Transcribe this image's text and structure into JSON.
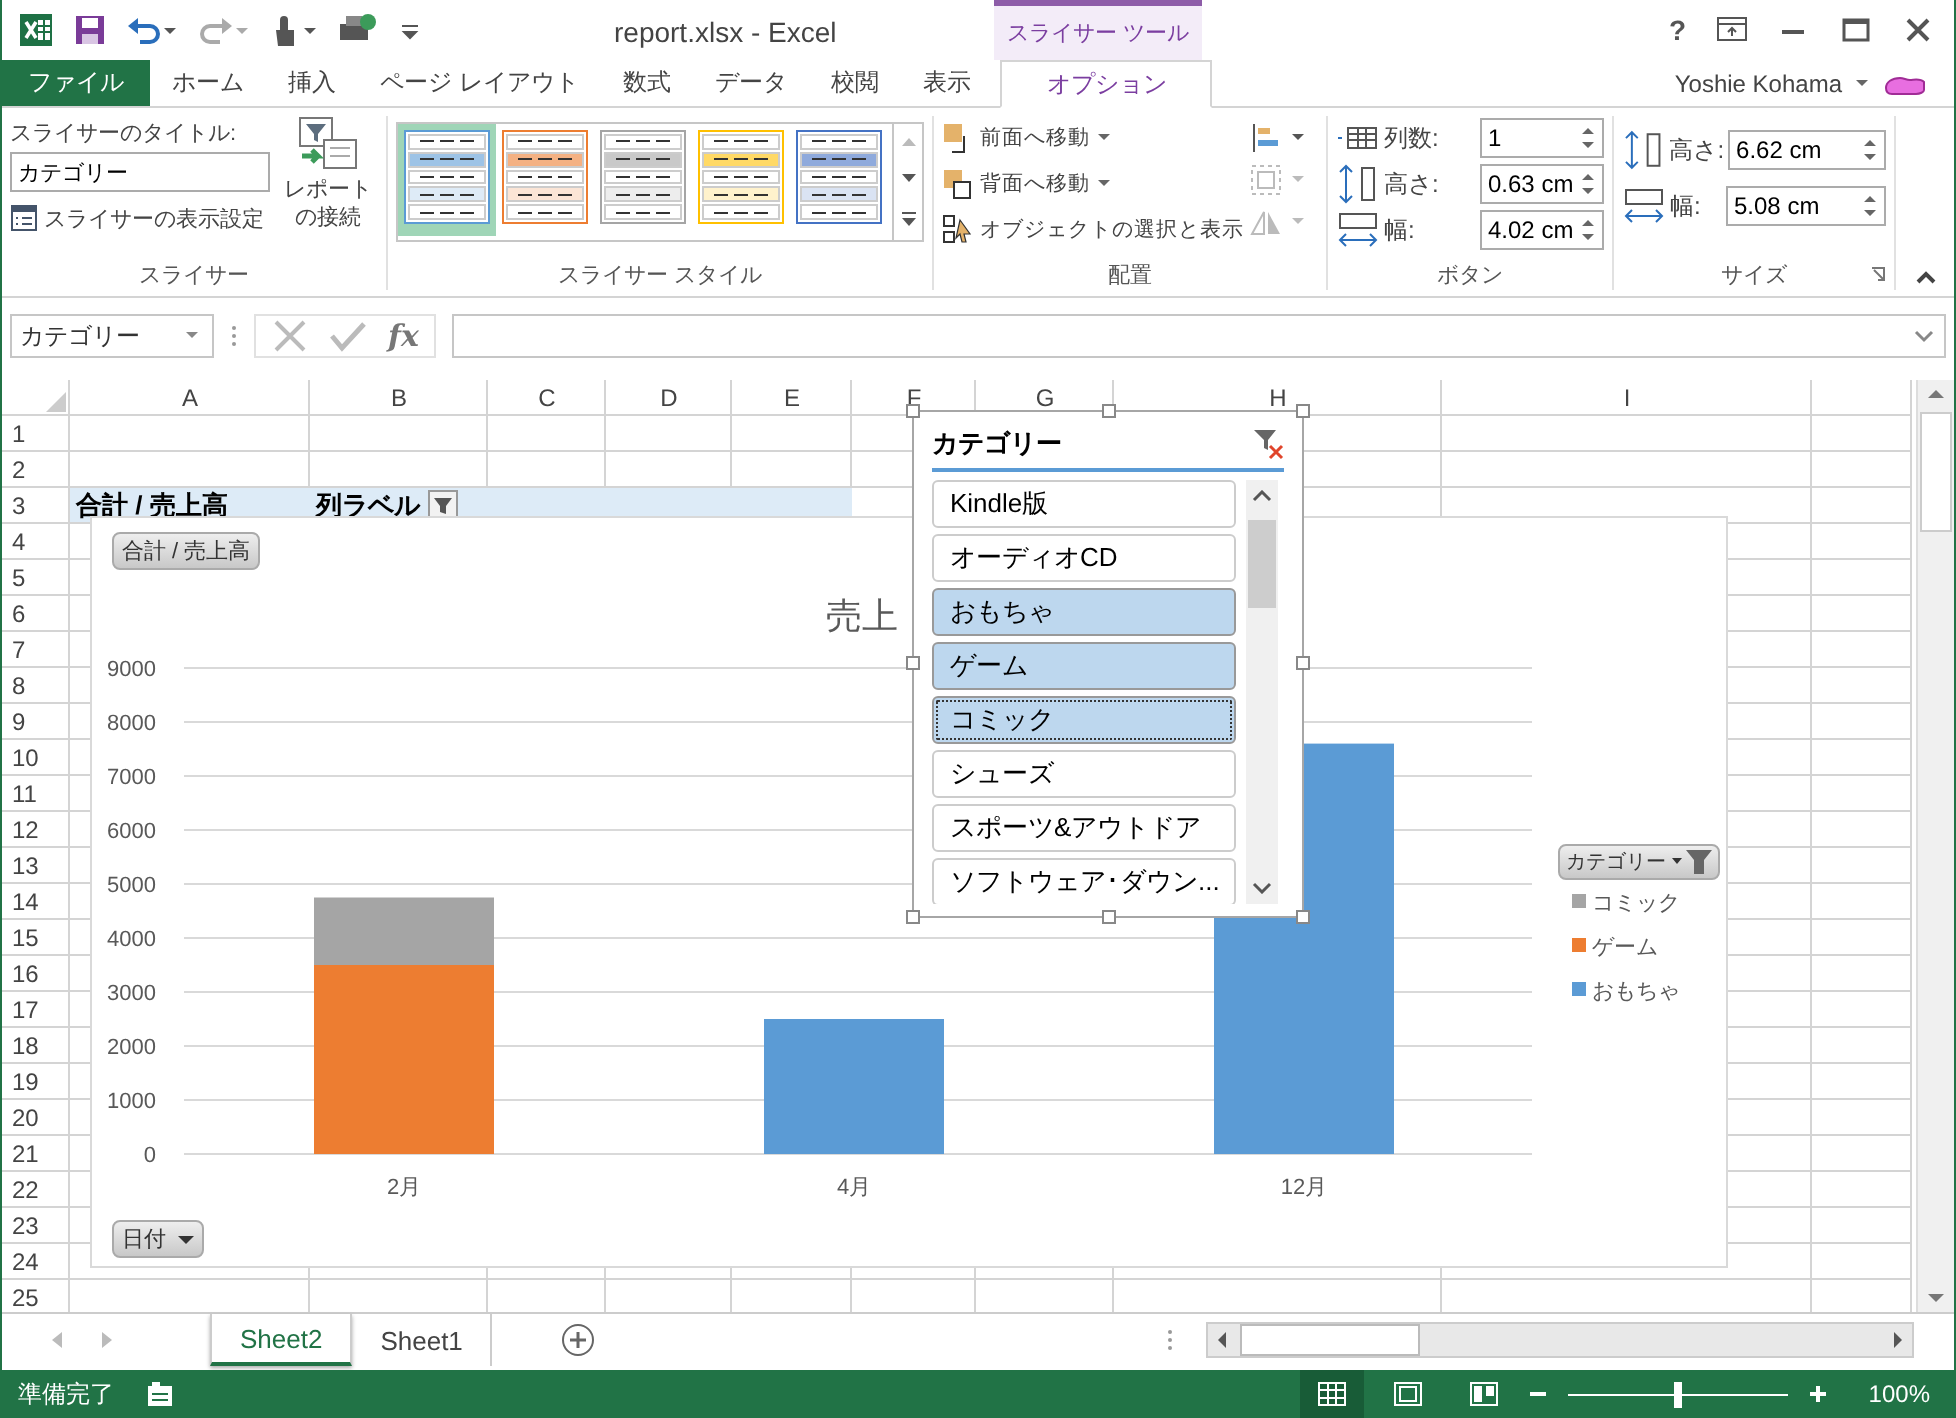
{
  "window": {
    "title": "report.xlsx - Excel",
    "help": "?"
  },
  "context_group": "スライサー ツール",
  "tabs": [
    {
      "label": "ファイル",
      "kind": "file",
      "selected": false
    },
    {
      "label": "ホーム",
      "kind": "tab",
      "selected": false
    },
    {
      "label": "挿入",
      "kind": "tab",
      "selected": false
    },
    {
      "label": "ページ レイアウト",
      "kind": "tab",
      "selected": false
    },
    {
      "label": "数式",
      "kind": "tab",
      "selected": false
    },
    {
      "label": "データ",
      "kind": "tab",
      "selected": false
    },
    {
      "label": "校閲",
      "kind": "tab",
      "selected": false
    },
    {
      "label": "表示",
      "kind": "tab",
      "selected": false
    },
    {
      "label": "オプション",
      "kind": "context",
      "selected": true
    }
  ],
  "user": "Yoshie Kohama",
  "slicer_group": {
    "caption_label": "スライサーのタイトル:",
    "caption_value": "カテゴリー",
    "settings_button": "スライサーの表示設定",
    "connections_button": "レポートの接続",
    "label": "スライサー"
  },
  "styles_group": {
    "label": "スライサー スタイル",
    "styles": [
      {
        "color": "#5b9bd5",
        "selected": true
      },
      {
        "color": "#ed7d31",
        "selected": false
      },
      {
        "color": "#a5a5a5",
        "selected": false
      },
      {
        "color": "#ffc000",
        "selected": false
      },
      {
        "color": "#4472c4",
        "selected": false
      }
    ]
  },
  "arrange_group": {
    "label": "配置",
    "buttons": [
      {
        "label": "前面へ移動",
        "kind": "forward"
      },
      {
        "label": "背面へ移動",
        "kind": "backward"
      },
      {
        "label": "オブジェクトの選択と表示",
        "kind": "selection"
      }
    ],
    "tools": [
      {
        "kind": "align",
        "disabled": false
      },
      {
        "kind": "group",
        "disabled": true
      },
      {
        "kind": "rotate",
        "disabled": true
      }
    ]
  },
  "buttons_group": {
    "label": "ボタン",
    "fields": [
      {
        "label": "列数:",
        "value": "1",
        "kind": "columns"
      },
      {
        "label": "高さ:",
        "value": "0.63 cm",
        "kind": "height"
      },
      {
        "label": "幅:",
        "value": "4.02 cm",
        "kind": "width"
      }
    ]
  },
  "size_group": {
    "label": "サイズ",
    "fields": [
      {
        "label": "高さ:",
        "value": "6.62 cm",
        "kind": "height"
      },
      {
        "label": "幅:",
        "value": "5.08 cm",
        "kind": "width"
      }
    ]
  },
  "name_box": "カテゴリー",
  "formula_bar": {
    "function_label": "fx"
  },
  "sheet": {
    "columns": [
      "A",
      "B",
      "C",
      "D",
      "E",
      "F",
      "G",
      "H",
      "I"
    ],
    "rows": [
      {
        "label": "1",
        "cells": []
      },
      {
        "label": "2",
        "cells": []
      },
      {
        "label": "3",
        "cells": [
          {
            "text": "合計 / 売上高",
            "kind": "pivot_header"
          },
          {
            "text": "列ラベル",
            "kind": "pivot_filter"
          },
          {
            "kind": "pivot_band"
          },
          {
            "kind": "pivot_band"
          },
          {
            "kind": "pivot_band"
          }
        ]
      },
      {
        "label": "4",
        "cells": []
      },
      {
        "label": "5",
        "cells": []
      },
      {
        "label": "6",
        "cells": []
      },
      {
        "label": "7",
        "cells": []
      },
      {
        "label": "8",
        "cells": []
      },
      {
        "label": "9",
        "cells": []
      },
      {
        "label": "10",
        "cells": []
      },
      {
        "label": "11",
        "cells": []
      },
      {
        "label": "12",
        "cells": []
      },
      {
        "label": "13",
        "cells": []
      },
      {
        "label": "14",
        "cells": []
      },
      {
        "label": "15",
        "cells": []
      },
      {
        "label": "16",
        "cells": []
      },
      {
        "label": "17",
        "cells": []
      },
      {
        "label": "18",
        "cells": []
      },
      {
        "label": "19",
        "cells": []
      },
      {
        "label": "20",
        "cells": []
      },
      {
        "label": "21",
        "cells": []
      },
      {
        "label": "22",
        "cells": []
      },
      {
        "label": "23",
        "cells": []
      },
      {
        "label": "24",
        "cells": []
      },
      {
        "label": "25",
        "cells": []
      }
    ]
  },
  "chart": {
    "value_button": "合計 / 売上高",
    "axis_button": "日付",
    "legend_button": "カテゴリー",
    "chart_data": {
      "type": "bar",
      "title": "売上",
      "categories": [
        "2月",
        "4月",
        "12月"
      ],
      "stacked": true,
      "grid": true,
      "legend": "right",
      "ylim": [
        0,
        9000
      ],
      "yticks": [
        0,
        1000,
        2000,
        3000,
        4000,
        5000,
        6000,
        7000,
        8000,
        9000
      ],
      "series": [
        {
          "name": "おもちゃ",
          "color": "#5b9bd5",
          "values": [
            null,
            2500,
            7600
          ]
        },
        {
          "name": "ゲーム",
          "color": "#ed7d31",
          "values": [
            3500,
            null,
            null
          ]
        },
        {
          "name": "コミック",
          "color": "#a5a5a5",
          "values": [
            1250,
            null,
            null
          ]
        }
      ]
    }
  },
  "slicer": {
    "title": "カテゴリー",
    "items": [
      {
        "label": "Kindle版",
        "selected": false,
        "focused": false
      },
      {
        "label": "オーディオCD",
        "selected": false,
        "focused": false
      },
      {
        "label": "おもちゃ",
        "selected": true,
        "focused": false
      },
      {
        "label": "ゲーム",
        "selected": true,
        "focused": false
      },
      {
        "label": "コミック",
        "selected": true,
        "focused": true
      },
      {
        "label": "シューズ",
        "selected": false,
        "focused": false
      },
      {
        "label": "スポーツ&アウトドア",
        "selected": false,
        "focused": false
      },
      {
        "label": "ソフトウェア･ダウン...",
        "selected": false,
        "focused": false
      }
    ]
  },
  "sheet_tabs": [
    {
      "label": "Sheet2",
      "selected": true
    },
    {
      "label": "Sheet1",
      "selected": false
    }
  ],
  "status_bar": {
    "status": "準備完了",
    "views": [
      {
        "kind": "normal",
        "selected": true
      },
      {
        "kind": "page_layout",
        "selected": false
      },
      {
        "kind": "page_break",
        "selected": false
      }
    ],
    "zoom": {
      "level": 0.5
    },
    "zoom_text": "100%"
  }
}
